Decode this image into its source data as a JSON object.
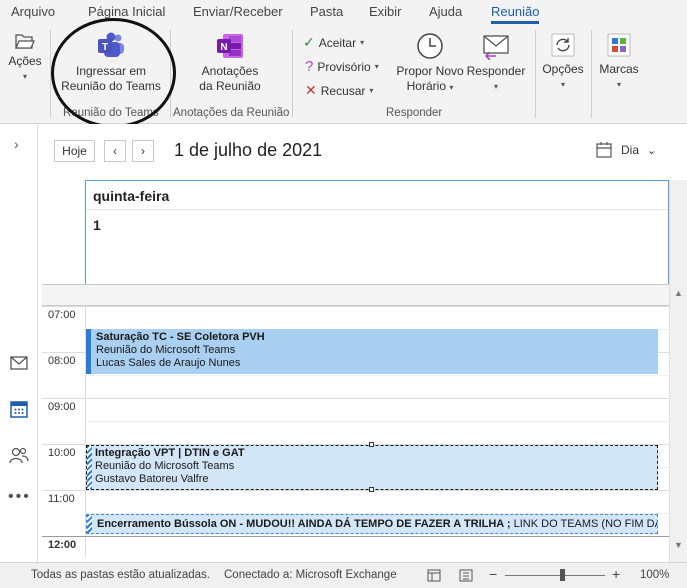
{
  "tabs": [
    "Arquivo",
    "Página Inicial",
    "Enviar/Receber",
    "Pasta",
    "Exibir",
    "Ajuda",
    "Reunião"
  ],
  "ribbon": {
    "acoes": "Ações",
    "teams_line1": "Ingressar em",
    "teams_line2": "Reunião do Teams",
    "teams_group": "Reunião do Teams",
    "notes_line1": "Anotações",
    "notes_line2": "da Reunião",
    "notes_group": "Anotações da Reunião",
    "aceitar": "Aceitar",
    "provisorio": "Provisório",
    "recusar": "Recusar",
    "propor_line1": "Propor Novo",
    "propor_line2": "Horário",
    "responder": "Responder",
    "responder_group": "Responder",
    "opcoes": "Opções",
    "marcas": "Marcas"
  },
  "calendar": {
    "today_button": "Hoje",
    "date_title": "1 de julho de 2021",
    "view_label": "Dia",
    "day_name": "quinta-feira",
    "day_number": "1",
    "times": [
      "07:00",
      "08:00",
      "09:00",
      "10:00",
      "11:00",
      "12:00"
    ]
  },
  "events": [
    {
      "title": "Saturação TC - SE Coletora PVH",
      "location": "Reunião do Microsoft Teams",
      "organizer": "Lucas Sales de Araujo Nunes"
    },
    {
      "title": "Integração VPT | DTIN e GAT",
      "location": "Reunião do Microsoft Teams",
      "organizer": "Gustavo Batoreu Valfre"
    },
    {
      "title": "Encerramento Bússola ON - MUDOU!!  AINDA DÁ TEMPO DE FAZER A TRILHA ;",
      "location": "LINK DO TEAMS (NO FIM DA"
    }
  ],
  "status": {
    "left": "Todas as pastas estão atualizadas.",
    "connection": "Conectado a: Microsoft Exchange",
    "zoom": "100%"
  },
  "colors": {
    "accent": "#1d5fa8",
    "event_busy": "#a9cff1",
    "event_tentative": "#d2e6f8"
  }
}
